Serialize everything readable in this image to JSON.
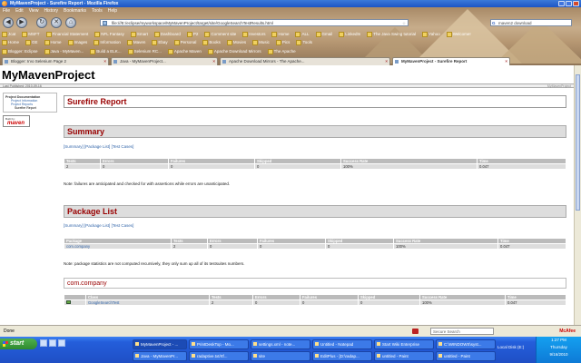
{
  "window": {
    "title": "MyMavenProject - Surefire Report - Mozilla Firefox"
  },
  "menu": [
    "File",
    "Edit",
    "View",
    "History",
    "Bookmarks",
    "Tools",
    "Help"
  ],
  "nav": {
    "url": "file:///E:/eclipse/myworkspace/MyMavenProject/target/site/GoogleSearchTestResults.html",
    "search_value": "maven2 download"
  },
  "bookmarks": {
    "row1": [
      "Jcat",
      "MSFT",
      "Financial Statement",
      "NFL Fantasy",
      "Smart",
      "Dashboard",
      "P2",
      "Comment site",
      "Investors",
      "Home",
      "ALL",
      "Gmail",
      "LinkedIn",
      "The Java Swing tutorial",
      "Yahoo",
      "Welcome!"
    ],
    "row2": [
      "Home",
      "GE",
      "Home",
      "Images",
      "Information",
      "Maven",
      "Ebay",
      "Personal",
      "Books",
      "Movies",
      "Music",
      "Pics",
      "Tools"
    ],
    "row3": [
      "Blogger: Eclipse",
      "Java - MyMaven...",
      "Build a ELK...",
      "Selenium RC...",
      "Apache Maven",
      "Apache Download Mirrors",
      "The Apache"
    ]
  },
  "tabs": [
    {
      "label": "Blogger: Irvo Selenium Page 2"
    },
    {
      "label": "Java - MyMavenProject..."
    },
    {
      "label": "Apache Download Mirrors - The Apache..."
    },
    {
      "label": "MyMavenProject - Surefire Report"
    }
  ],
  "site": {
    "title": "MyMavenProject",
    "published": "Last Published: 2010-09-16",
    "crumb_right": "MyMavenProject"
  },
  "leftnav": {
    "header": "Project Documentation",
    "items": [
      "Project Information",
      "Project Reports",
      "Surefire Report"
    ],
    "logo_built": "Built by:",
    "logo_maven": "maven"
  },
  "report": {
    "title": "Surefire Report",
    "links": {
      "summary": "[Summary]",
      "package_list": "[Package List]",
      "test_cases": "[Test Cases]"
    },
    "summary": {
      "title": "Summary",
      "headers": [
        "Tests",
        "Errors",
        "Failures",
        "Skipped",
        "Success Rate",
        "Time"
      ],
      "row": [
        "2",
        "0",
        "0",
        "0",
        "100%",
        "0.047"
      ],
      "note": "Note: failures are anticipated and checked for with assertions while errors are unanticipated."
    },
    "package_list": {
      "title": "Package List",
      "headers": [
        "Package",
        "Tests",
        "Errors",
        "Failures",
        "Skipped",
        "Success Rate",
        "Time"
      ],
      "row": [
        "com.company",
        "2",
        "0",
        "0",
        "0",
        "100%",
        "0.047"
      ],
      "note": "Note: package statistics are not computed recursively, they only sum up all of its testsuites numbers."
    },
    "package": {
      "name": "com.company",
      "headers": [
        "",
        "Class",
        "Tests",
        "Errors",
        "Failures",
        "Skipped",
        "Success Rate",
        "Time"
      ],
      "row": [
        "",
        "GoogleSearchTest",
        "2",
        "0",
        "0",
        "0",
        "100%",
        "0.047"
      ]
    }
  },
  "status": {
    "text": "Done",
    "mini_search": "Secure Search",
    "mcafee": "McAfee"
  },
  "taskbar": {
    "start": "start",
    "buttons_row1": [
      "MyMavenProject - ...",
      "PrintDeskTop - Mo...",
      "settings.xml - note...",
      "Untitled - Notepad",
      "Start Wiki Enterprise",
      "C:\\WINDOWS\\syst..."
    ],
    "buttons_row2": [
      "Java - MyMavenPr...",
      "radaptive.txt/rtf...",
      "site",
      "EditPlus - [D:\\radap...",
      "untitled - Paint",
      "untitled - Paint"
    ],
    "local_disk": "Local Disk (E:)",
    "time": "1:27 PM",
    "day": "Thursday",
    "date": "9/16/2010"
  }
}
